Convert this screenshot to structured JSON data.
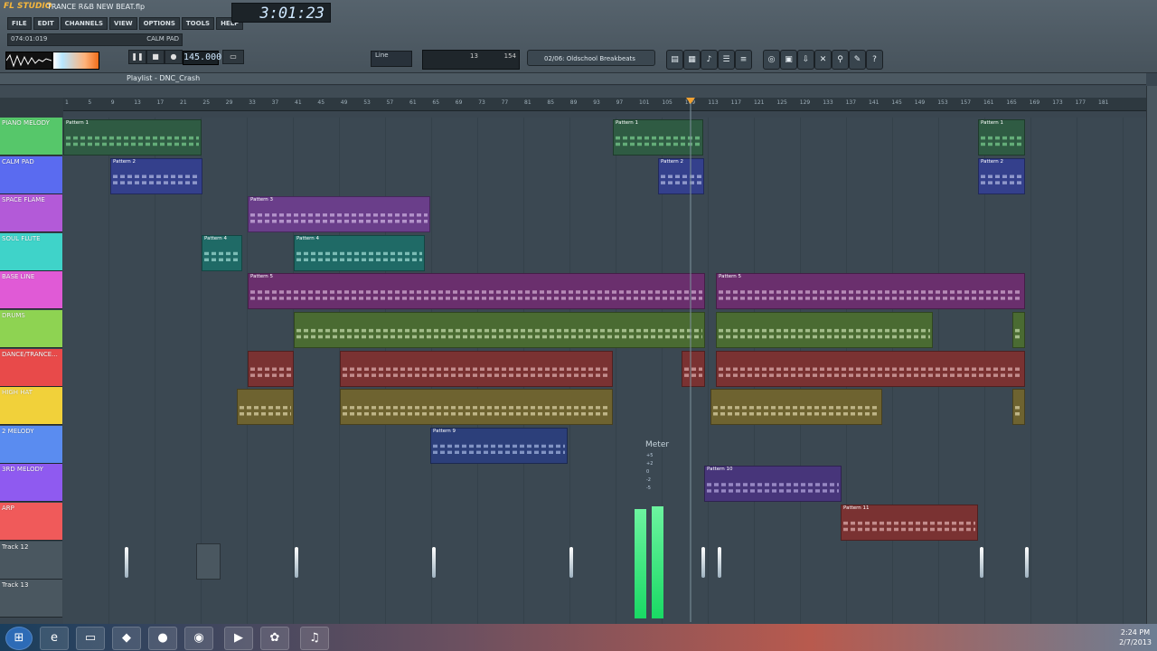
{
  "app": {
    "name": "FL STUDIO",
    "project": "TRANCE R&B NEW BEAT.flp"
  },
  "menu": [
    "FILE",
    "EDIT",
    "CHANNELS",
    "VIEW",
    "OPTIONS",
    "TOOLS",
    "HELP"
  ],
  "hint": {
    "position": "074:01:019",
    "label": "CALM PAD"
  },
  "clock": "3:01:23",
  "tempo": "145.000",
  "mode": "Line",
  "cpu": {
    "value": "13",
    "mem": "154"
  },
  "browser": "02/06: Oldschool Breakbeats",
  "playlist_title": "Playlist - DNC_Crash",
  "ruler": [
    "1",
    "5",
    "9",
    "13",
    "17",
    "21",
    "25",
    "29",
    "33",
    "37",
    "41",
    "45",
    "49",
    "53",
    "57",
    "61",
    "65",
    "69",
    "73",
    "77",
    "81",
    "85",
    "89",
    "93",
    "97",
    "101",
    "105",
    "109",
    "113",
    "117",
    "121",
    "125",
    "129",
    "133",
    "137",
    "141",
    "145",
    "149",
    "153",
    "157",
    "161",
    "165",
    "169",
    "173",
    "177",
    "181"
  ],
  "tracks": [
    {
      "name": "PIANO MELODY",
      "color": "#56c76a"
    },
    {
      "name": "CALM PAD",
      "color": "#5a6bf0"
    },
    {
      "name": "SPACE FLAME",
      "color": "#b35ad8"
    },
    {
      "name": "SOUL FLUTE",
      "color": "#3fd3c9"
    },
    {
      "name": "BASE LINE",
      "color": "#e05ad6"
    },
    {
      "name": "DRUMS",
      "color": "#8ed352"
    },
    {
      "name": "DANCE/TRANCE...",
      "color": "#e84a4a"
    },
    {
      "name": "HIGH HAT",
      "color": "#f1d13a"
    },
    {
      "name": "2 MELODY",
      "color": "#5a8cf0"
    },
    {
      "name": "3RD MELODY",
      "color": "#8f5af0"
    },
    {
      "name": "ARP",
      "color": "#f05a5a"
    },
    {
      "name": "Track 12",
      "color": "#4a5760"
    },
    {
      "name": "Track 13",
      "color": "#4a5760"
    }
  ],
  "clips": {
    "pattern1": "Pattern 1",
    "pattern2": "Pattern 2",
    "pattern3": "Pattern 3",
    "pattern4": "Pattern 4",
    "pattern5": "Pattern 5",
    "pattern9": "Pattern 9",
    "pattern10": "Pattern 10",
    "pattern11": "Pattern 11"
  },
  "meter": {
    "label": "Meter",
    "ticks": [
      "+5",
      "+2",
      "0",
      "-2",
      "-5"
    ]
  },
  "tray": {
    "time": "2:24 PM",
    "date": "2/7/2013"
  }
}
